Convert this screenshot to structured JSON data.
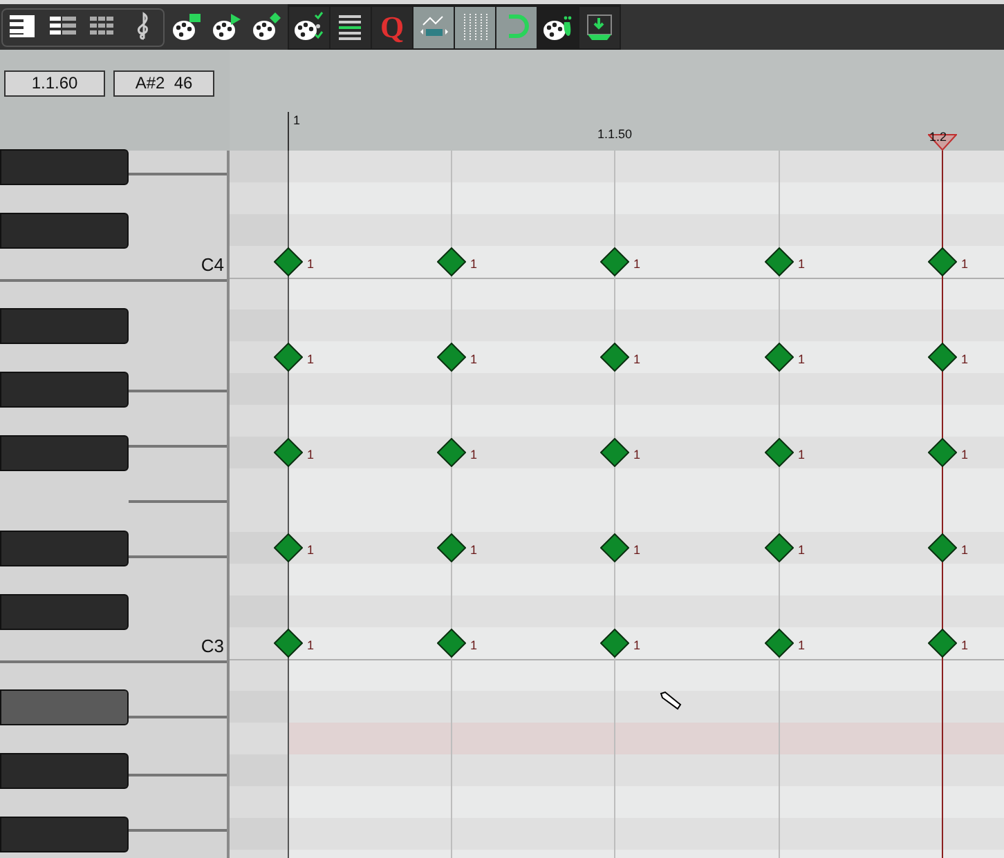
{
  "toolbar": [
    {
      "kind": "piano-roll",
      "active": false
    },
    {
      "kind": "named-notes",
      "active": false
    },
    {
      "kind": "drum-grid",
      "active": false
    },
    {
      "kind": "clef",
      "active": false
    },
    {
      "kind": "insert-note",
      "active": false
    },
    {
      "kind": "play-note",
      "active": false
    },
    {
      "kind": "diamond-note",
      "active": false
    },
    {
      "kind": "checklist",
      "active": false
    },
    {
      "kind": "event-list",
      "active": false
    },
    {
      "kind": "quantize",
      "label": "Q",
      "active": false
    },
    {
      "kind": "cc-lane",
      "active": true
    },
    {
      "kind": "grid-lines",
      "active": true
    },
    {
      "kind": "magnet",
      "active": true
    },
    {
      "kind": "footprint",
      "active": false
    },
    {
      "kind": "insert-down",
      "active": false
    }
  ],
  "fields": [
    {
      "value": "1.1.60"
    },
    {
      "value": "A#2  46"
    }
  ],
  "ruler": {
    "labels": [
      "1",
      "1.1.50",
      "1.2"
    ]
  },
  "piano": {
    "labels": [
      "C4",
      "C3"
    ],
    "black_keys": [
      {
        "hovered": false
      },
      {
        "hovered": false
      },
      {
        "hovered": false
      },
      {
        "hovered": false
      },
      {
        "hovered": false
      },
      {
        "hovered": false
      },
      {
        "hovered": false
      },
      {
        "hovered": true
      },
      {
        "hovered": false
      },
      {
        "hovered": false
      }
    ]
  },
  "note_rows": [
    {
      "notes": [
        "1",
        "1",
        "1",
        "1",
        "1"
      ]
    },
    {
      "notes": [
        "1",
        "1",
        "1",
        "1",
        "1"
      ]
    },
    {
      "notes": [
        "1",
        "1",
        "1",
        "1",
        "1"
      ]
    },
    {
      "notes": [
        "1",
        "1",
        "1",
        "1",
        "1"
      ]
    },
    {
      "notes": [
        "1",
        "1",
        "1",
        "1",
        "1"
      ]
    }
  ]
}
